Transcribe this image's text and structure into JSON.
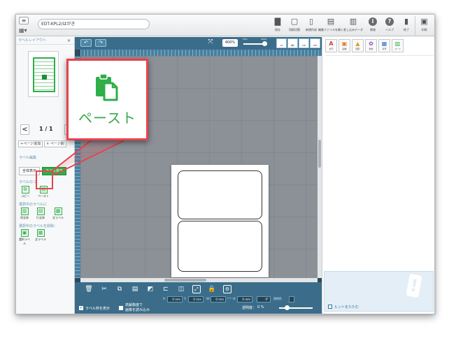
{
  "window": {
    "title_field": "EDT-KPL2/はがき"
  },
  "top_toolbar": {
    "items": [
      {
        "label": "保存",
        "icon": "save-icon"
      },
      {
        "label": "用紙切替",
        "icon": "paper-switch-icon"
      },
      {
        "label": "新規作成",
        "icon": "new-doc-icon"
      },
      {
        "label": "編集ファイルを開く",
        "icon": "open-file-icon"
      },
      {
        "label": "差し込みデータ",
        "icon": "merge-data-icon"
      },
      {
        "label": "情報",
        "icon": "info-icon"
      },
      {
        "label": "ヘルプ",
        "icon": "help-icon"
      },
      {
        "label": "終了",
        "icon": "exit-icon"
      },
      {
        "label": "印刷",
        "icon": "print-icon"
      }
    ]
  },
  "left_panel": {
    "title": "ラベルレイアウト",
    "close": "×",
    "page_indicator": "1 / 1",
    "prev": "<",
    "next": ">",
    "add_page": "+ページ追加",
    "delete_page": "× ページ削",
    "section_label_edit": "ラベル編集",
    "tab_all": "全体表示",
    "tab_label": "ラベル表示",
    "section_label_copy": "ラベルのコ",
    "copy_btn": "コピー",
    "paste_btn": "ペースト",
    "section_select": "選択中のラベルに",
    "sel_btn_1": "同全体",
    "sel_btn_2": "行全体",
    "sel_btn_3": "全ラベル",
    "section_delete": "選択中のラベルを削除：",
    "del_btn_1": "選択ラベル",
    "del_btn_2": "全ラベル"
  },
  "canvas": {
    "zoom_value": "400%",
    "zoom_min": "25%",
    "zoom_max": "400%",
    "zoom_level": 1.0,
    "view_buttons": [
      "1P",
      "横P",
      "1SP",
      "2SP"
    ],
    "coords": {
      "x_label": "X:",
      "x_value": "0 mm",
      "y_label": "Y:",
      "y_value": "0 mm",
      "w_label": "W:",
      "w_value": "0 mm",
      "h_label": "H:",
      "h_value": "0 mm",
      "angle_value": "0°",
      "transparent_label": "透明色"
    },
    "show_frame_label": "ラベル枠を表示",
    "hires_label_line1": "高解像度で",
    "hires_label_line2": "画像を読み込み",
    "opacity_label": "透明度：",
    "opacity_value": "0 %",
    "opacity_level": 0.0
  },
  "right_panel": {
    "tools": [
      {
        "label": "文字",
        "glyph": "A",
        "color": "#e23b3b"
      },
      {
        "label": "画像",
        "glyph": "▣",
        "color": "#e07a2b"
      },
      {
        "label": "図形",
        "glyph": "▲",
        "color": "#d6a51c"
      },
      {
        "label": "素材",
        "glyph": "✿",
        "color": "#8a4db3"
      },
      {
        "label": "背景",
        "glyph": "▦",
        "color": "#3b6fc4"
      },
      {
        "label": "コード",
        "glyph": "▥",
        "color": "#2fae49"
      }
    ],
    "hint_label": "ヒントをたたむ"
  },
  "callout": {
    "label": "ペースト"
  },
  "colors": {
    "accent_green": "#2fae49",
    "callout_red": "#e8424f",
    "toolbar_blue": "#3b6d8a"
  }
}
